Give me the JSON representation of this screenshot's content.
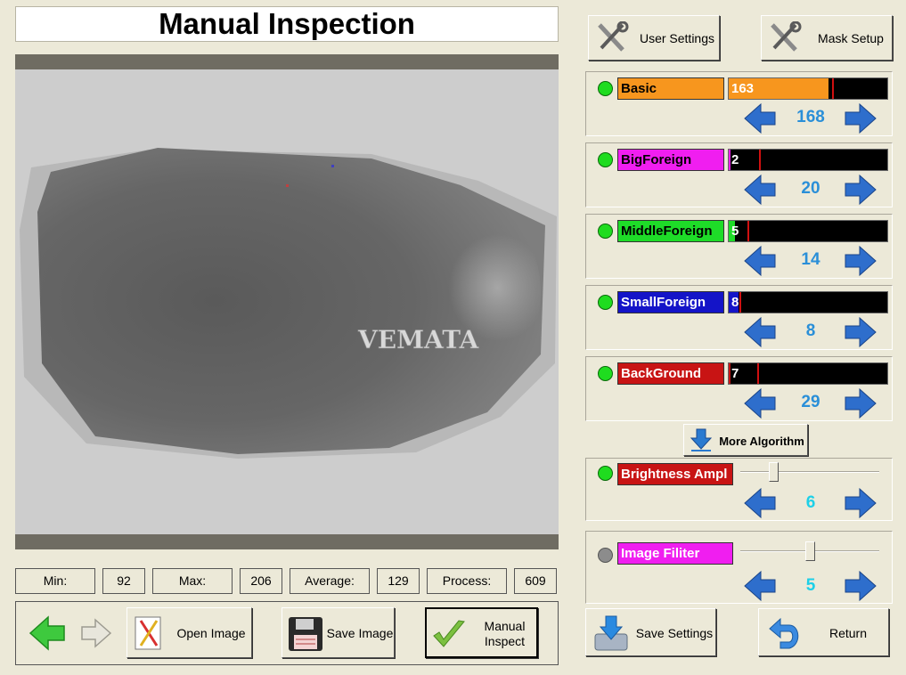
{
  "title": "Manual Inspection",
  "watermark": "VEMATA",
  "stats": {
    "min_label": "Min:",
    "min_value": "92",
    "max_label": "Max:",
    "max_value": "206",
    "average_label": "Average:",
    "average_value": "129",
    "process_label": "Process:",
    "process_value": "609"
  },
  "toolbar": {
    "open_image": "Open Image",
    "save_image": "Save Image",
    "manual_inspect_line1": "Manual",
    "manual_inspect_line2": "Inspect"
  },
  "top_buttons": {
    "user_settings": "User Settings",
    "mask_setup": "Mask Setup"
  },
  "algorithms": [
    {
      "name": "Basic",
      "color": "#f7961e",
      "reading": "163",
      "reading_fraction": 0.63,
      "threshold_fraction": 0.65,
      "setting": "168"
    },
    {
      "name": "BigForeign",
      "color": "#f01ef0",
      "reading": "2",
      "reading_fraction": 0.01,
      "threshold_fraction": 0.19,
      "setting": "20"
    },
    {
      "name": "MiddleForeign",
      "color": "#1edc28",
      "reading": "5",
      "reading_fraction": 0.04,
      "threshold_fraction": 0.12,
      "setting": "14"
    },
    {
      "name": "SmallForeign",
      "color": "#1414c8",
      "reading": "8",
      "reading_fraction": 0.06,
      "threshold_fraction": 0.07,
      "setting": "8"
    },
    {
      "name": "BackGround",
      "color": "#c81414",
      "reading": "7",
      "reading_fraction": 0.01,
      "threshold_fraction": 0.18,
      "setting": "29"
    }
  ],
  "more_algorithm": "More Algorithm",
  "brightness": {
    "label": "Brightness Ampl",
    "color": "#c81414",
    "value": "6",
    "slider_fraction": 0.22
  },
  "image_filter": {
    "label": "Image Filiter",
    "color": "#f01ef0",
    "value": "5",
    "slider_fraction": 0.5
  },
  "save_settings": "Save Settings",
  "return": "Return"
}
